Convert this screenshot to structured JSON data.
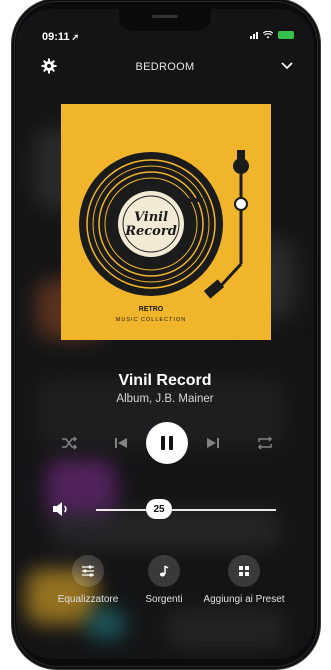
{
  "status": {
    "time": "09:11"
  },
  "header": {
    "room": "BEDROOM"
  },
  "album": {
    "cover_line1": "Vinil",
    "cover_line2": "Record",
    "cover_retro": "RETRO",
    "cover_collection": "MUSIC COLLECTION"
  },
  "track": {
    "title": "Vinil Record",
    "subtitle": "Album, J.B. Mainer"
  },
  "volume": {
    "level": 25,
    "label": "25"
  },
  "actions": [
    {
      "label": "Equalizzatore",
      "icon": "equalizer-icon"
    },
    {
      "label": "Sorgenti",
      "icon": "music-note-icon"
    },
    {
      "label": "Aggiungi ai Preset",
      "icon": "grid-icon"
    }
  ],
  "colors": {
    "album_bg": "#f1b52b",
    "battery": "#35c24a"
  }
}
